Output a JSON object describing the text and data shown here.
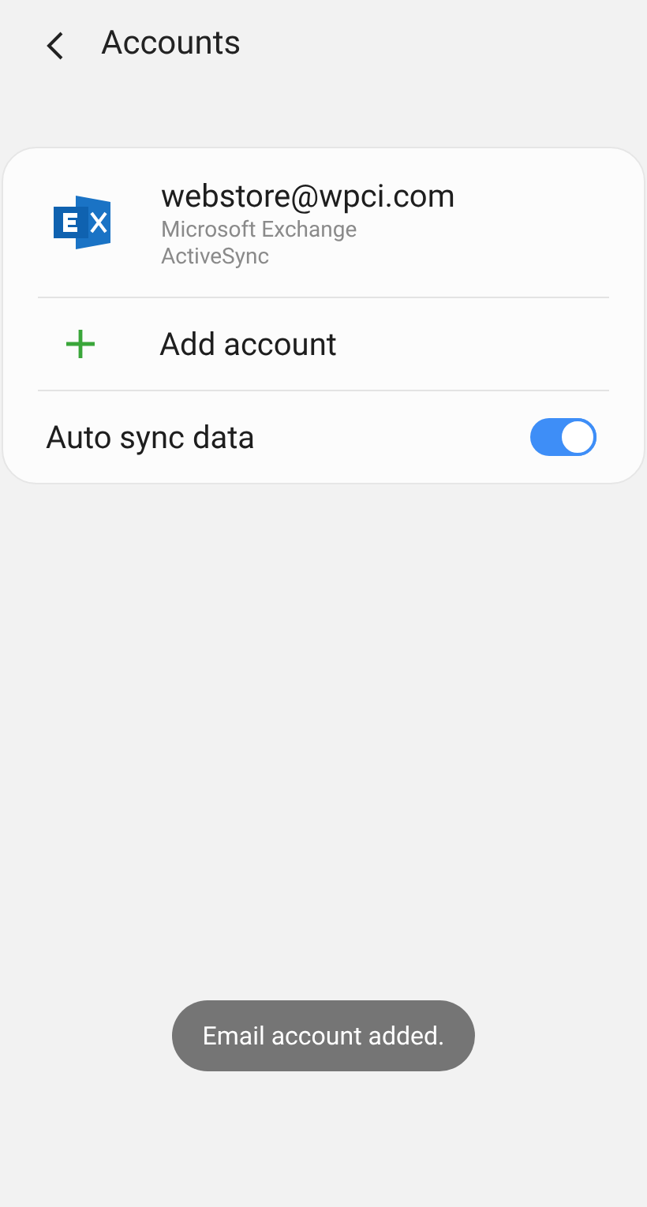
{
  "header": {
    "title": "Accounts"
  },
  "accounts": [
    {
      "email": "webstore@wpci.com",
      "type": "Microsoft Exchange ActiveSync"
    }
  ],
  "add_account": {
    "label": "Add account"
  },
  "auto_sync": {
    "label": "Auto sync data",
    "on": true
  },
  "toast": {
    "text": "Email account added."
  }
}
